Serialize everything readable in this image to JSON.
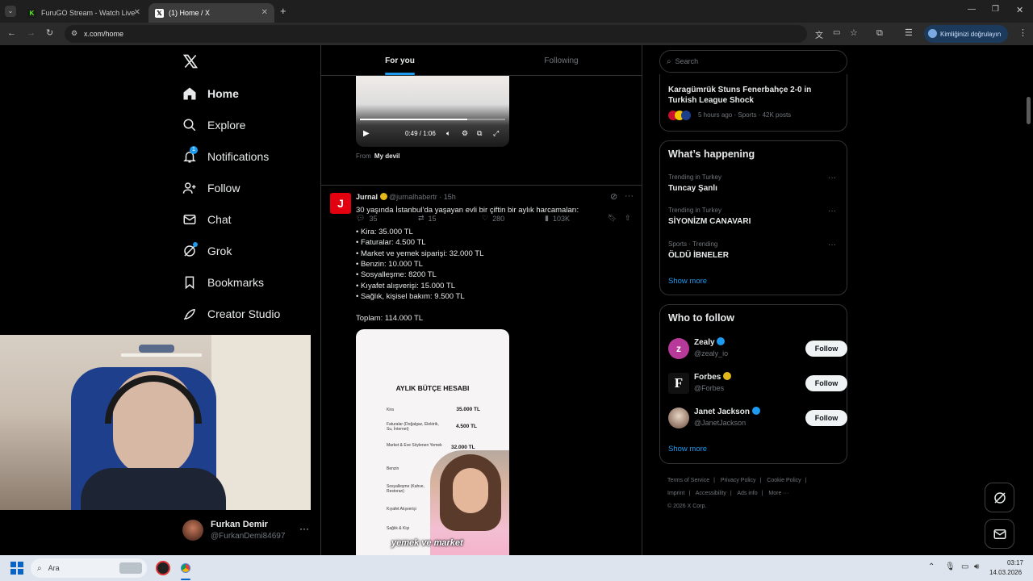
{
  "browser": {
    "tabs": [
      {
        "title": "FuruGO Stream - Watch Live on",
        "active": false
      },
      {
        "title": "(1) Home / X",
        "active": true
      }
    ],
    "url": "x.com/home",
    "verify_label": "Kimliğinizi doğrulayın"
  },
  "nav": {
    "items": [
      {
        "label": "Home",
        "icon": "home-icon",
        "active": true
      },
      {
        "label": "Explore",
        "icon": "search-icon"
      },
      {
        "label": "Notifications",
        "icon": "bell-icon",
        "badge": "1"
      },
      {
        "label": "Follow",
        "icon": "person-add-icon"
      },
      {
        "label": "Chat",
        "icon": "mail-icon"
      },
      {
        "label": "Grok",
        "icon": "grok-icon"
      },
      {
        "label": "Bookmarks",
        "icon": "bookmark-icon"
      },
      {
        "label": "Creator Studio",
        "icon": "rocket-icon"
      }
    ],
    "account": {
      "name": "Furkan Demir",
      "handle": "@FurkanDemi84697"
    }
  },
  "feed": {
    "tabs": {
      "for_you": "For you",
      "following": "Following"
    },
    "video": {
      "time": "0:49 / 1:06",
      "progress": 0.74
    },
    "from_label": "From",
    "from_source": "My devil",
    "actions": {
      "replies": "35",
      "reposts": "15",
      "likes": "280",
      "views": "103K"
    },
    "post": {
      "author": "Jurnal",
      "handle": "@jurnalhabertr",
      "time": "15h",
      "lines": [
        "30 yaşında İstanbul’da yaşayan evli bir çiftin bir aylık harcamaları:",
        "• Kira: 35.000 TL",
        "• Faturalar: 4.500 TL",
        "• Market ve yemek siparişi: 32.000 TL",
        "• Benzin: 10.000 TL",
        "• Sosyalleşme: 8200 TL",
        "• Kıyafet alışverişi: 15.000 TL",
        "• Sağlık, kişisel bakım: 9.500 TL",
        "Toplam: 114.000 TL"
      ],
      "image": {
        "title": "AYLIK BÜTÇE HESABI",
        "rows": [
          {
            "label": "Kira",
            "value": "35.000 TL"
          },
          {
            "label": "Faturalar (Doğalgaz, Elektrik, Su, İnternet)",
            "value": "4.500 TL"
          },
          {
            "label": "Market & Eve Söylenen Yemek",
            "value": "32.000 TL"
          },
          {
            "label": "Benzin",
            "value": ""
          },
          {
            "label": "Sosyalleşme (Kahve, Restoran)",
            "value": ""
          },
          {
            "label": "Kıyafet Alışverişi",
            "value": ""
          },
          {
            "label": "Sağlık & Kişi",
            "value": ""
          }
        ],
        "caption": "yemek ve market"
      }
    }
  },
  "right": {
    "search_placeholder": "Search",
    "top_trend": {
      "title": "Karagümrük Stuns Fenerbahçe 2-0 in Turkish League Shock",
      "meta": "5 hours ago · Sports · 42K posts"
    },
    "whats_happening": {
      "title": "What’s happening",
      "items": [
        {
          "meta": "Trending in Turkey",
          "title": "Tuncay Şanlı"
        },
        {
          "meta": "Trending in Turkey",
          "title": "SİYONİZM CANAVARI"
        },
        {
          "meta": "Sports · Trending",
          "title": "ÖLDÜ İBNELER"
        }
      ],
      "show_more": "Show more"
    },
    "who_to_follow": {
      "title": "Who to follow",
      "users": [
        {
          "name": "Zealy",
          "handle": "@zealy_io",
          "badge": "#1d9bf0"
        },
        {
          "name": "Forbes",
          "handle": "@Forbes",
          "badge": "#e2b719"
        },
        {
          "name": "Janet Jackson",
          "handle": "@JanetJackson",
          "badge": "#1d9bf0"
        }
      ],
      "follow_label": "Follow",
      "show_more": "Show more"
    },
    "footer": {
      "line1": [
        "Terms of Service",
        "Privacy Policy",
        "Cookie Policy"
      ],
      "line2": [
        "Imprint",
        "Accessibility",
        "Ads info",
        "More ···"
      ],
      "copyright": "© 2026 X Corp."
    }
  },
  "taskbar": {
    "search": "Ara",
    "time": "03:17",
    "date": "14.03.2026"
  },
  "colors": {
    "accent": "#1d9bf0",
    "background": "#000000",
    "border": "#2f3336",
    "muted": "#71767b",
    "jurnal_red": "#e3000f"
  }
}
